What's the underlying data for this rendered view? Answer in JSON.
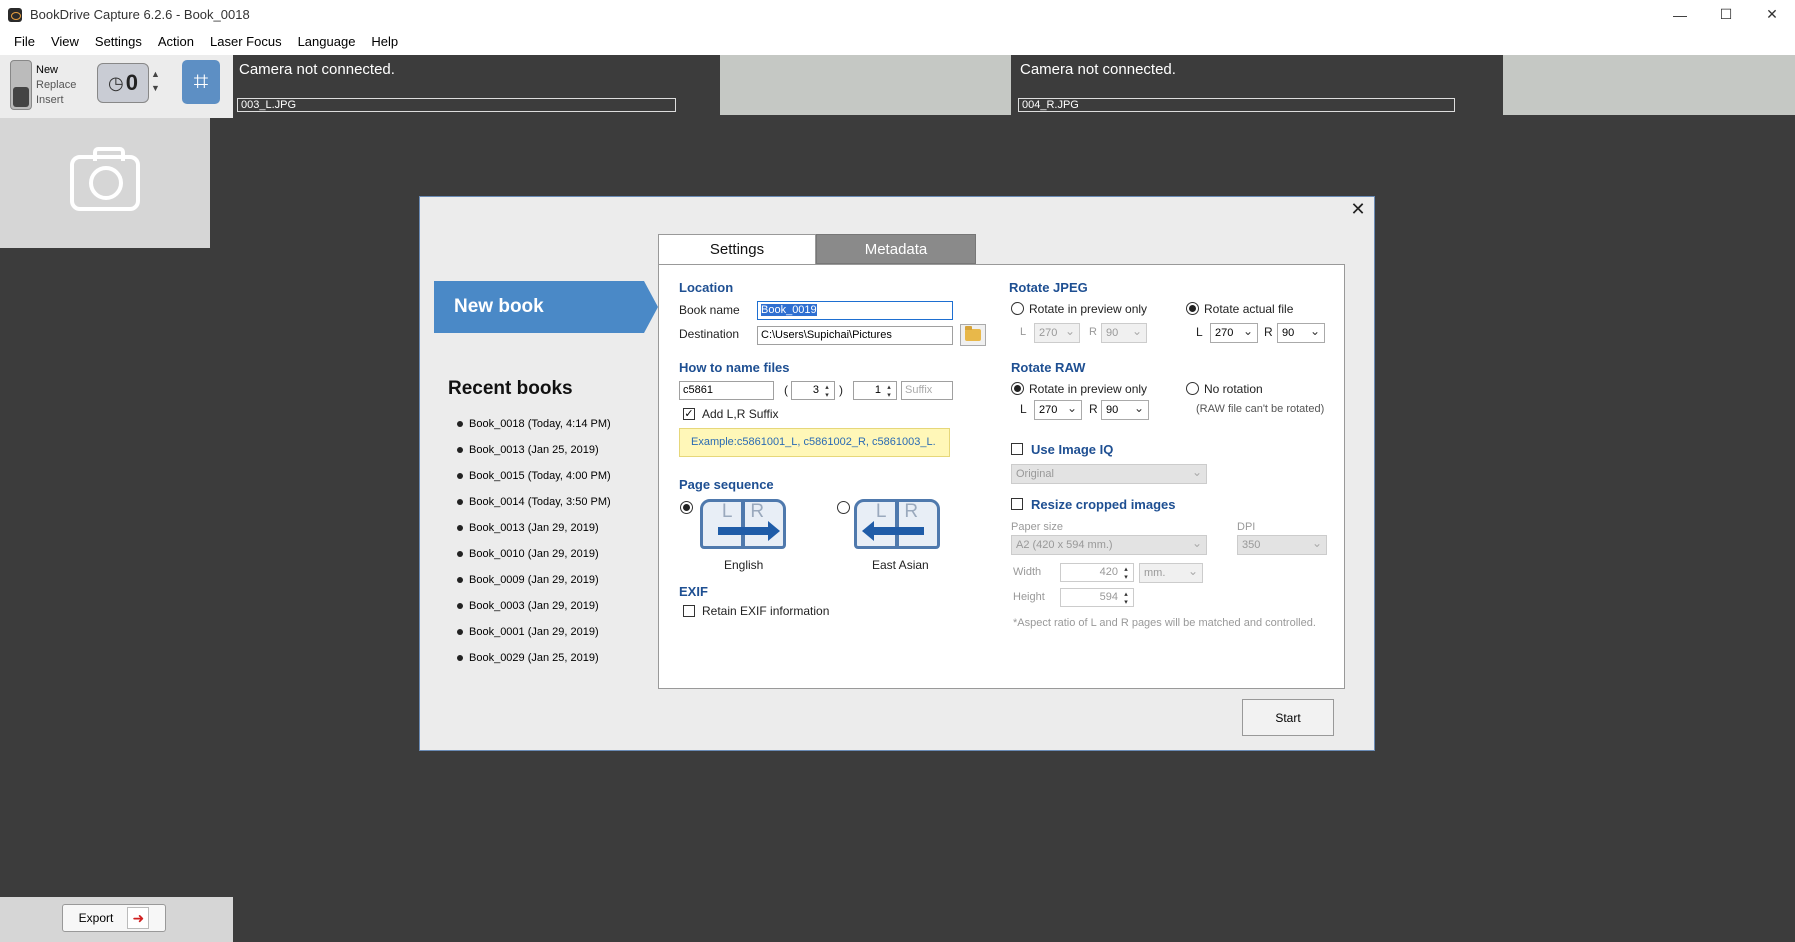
{
  "window": {
    "title": "BookDrive Capture 6.2.6 - Book_0018",
    "minimize": "—",
    "maximize": "☐",
    "close": "✕"
  },
  "menu": [
    "File",
    "View",
    "Settings",
    "Action",
    "Laser Focus",
    "Language",
    "Help"
  ],
  "toolbar": {
    "mode_new": "New",
    "mode_replace": "Replace",
    "mode_insert": "Insert",
    "timer_value": "0"
  },
  "cameras": {
    "left_status": "Camera not connected.",
    "left_file": "003_L.JPG",
    "right_status": "Camera not connected.",
    "right_file": "004_R.JPG"
  },
  "export_label": "Export",
  "dialog": {
    "close": "✕",
    "banner": "New book",
    "recent_title": "Recent books",
    "recent_books": [
      "Book_0018 (Today, 4:14 PM)",
      "Book_0013 (Jan 25, 2019)",
      "Book_0015 (Today, 4:00 PM)",
      "Book_0014 (Today, 3:50 PM)",
      "Book_0013 (Jan 29, 2019)",
      "Book_0010 (Jan 29, 2019)",
      "Book_0009 (Jan 29, 2019)",
      "Book_0003 (Jan 29, 2019)",
      "Book_0001 (Jan 29, 2019)",
      "Book_0029 (Jan 25, 2019)"
    ],
    "tabs": {
      "settings": "Settings",
      "metadata": "Metadata"
    },
    "location": {
      "title": "Location",
      "book_name_label": "Book name",
      "book_name": "Book_0019",
      "destination_label": "Destination",
      "destination": "C:\\Users\\Supichai\\Pictures"
    },
    "naming": {
      "title": "How to name files",
      "prefix": "c5861",
      "digits": "3",
      "start": "1",
      "suffix_placeholder": "Suffix",
      "open_paren": "(",
      "close_paren": ")",
      "add_lr_suffix": "Add L,R Suffix",
      "add_lr_checked": true,
      "example": "Example:c5861001_L, c5861002_R, c5861003_L."
    },
    "page_sequence": {
      "title": "Page sequence",
      "english": "English",
      "east_asian": "East Asian",
      "book_letters": "LR"
    },
    "exif": {
      "title": "EXIF",
      "retain": "Retain EXIF information",
      "checked": false
    },
    "rotate_jpeg": {
      "title": "Rotate JPEG",
      "preview_only": "Rotate in preview only",
      "actual_file": "Rotate actual file",
      "selected": "actual_file",
      "l_label": "L",
      "r_label": "R",
      "preview_l": "270",
      "preview_r": "90",
      "actual_l": "270",
      "actual_r": "90"
    },
    "rotate_raw": {
      "title": "Rotate RAW",
      "preview_only": "Rotate in preview only",
      "no_rotation": "No rotation",
      "selected": "preview_only",
      "l_label": "L",
      "r_label": "R",
      "l": "270",
      "r": "90",
      "note": "(RAW file can't be rotated)"
    },
    "image_iq": {
      "label": "Use Image IQ",
      "checked": false,
      "value": "Original"
    },
    "resize": {
      "label": "Resize cropped images",
      "checked": false,
      "paper_size_label": "Paper size",
      "paper_size": "A2 (420 x 594 mm.)",
      "dpi_label": "DPI",
      "dpi": "350",
      "width_label": "Width",
      "width": "420",
      "height_label": "Height",
      "height": "594",
      "unit": "mm.",
      "note": "*Aspect ratio of L and R pages will be matched and controlled."
    },
    "start": "Start"
  },
  "colors": {
    "accent_blue": "#4a89c7",
    "section_title": "#1e4f92",
    "example_bg": "#fff7b8"
  }
}
